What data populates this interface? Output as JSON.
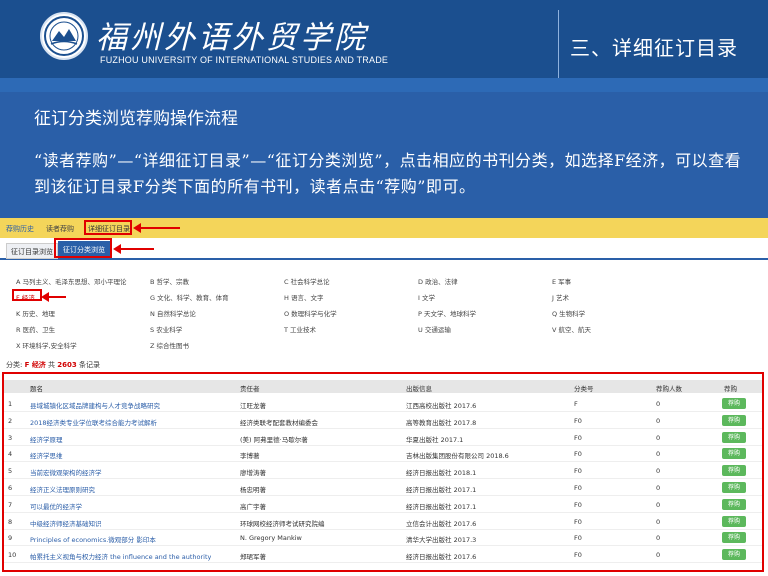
{
  "header": {
    "school_name_cn": "福州外语外贸学院",
    "school_name_en": "FUZHOU UNIVERSITY OF INTERNATIONAL STUDIES AND TRADE",
    "section_title": "三、详细征订目录"
  },
  "intro": {
    "title": "征订分类浏览荐购操作流程",
    "description": "“读者荐购”—“详细征订目录”—“征订分类浏览”，点击相应的书刊分类，如选择F经济，可以查看到该征订目录F分类下面的所有书刊，读者点击“荐购”即可。"
  },
  "nav": {
    "items": [
      "荐购历史",
      "读者荐购",
      "详细征订目录"
    ]
  },
  "tabs": {
    "items": [
      "征订目录浏览",
      "征订分类浏览"
    ]
  },
  "categories": [
    "A 马列主义、毛泽东思想、邓小平理论",
    "B 哲学、宗教",
    "C 社会科学总论",
    "D 政治、法律",
    "E 军事",
    "F 经济",
    "G 文化、科学、教育、体育",
    "H 语言、文字",
    "I 文学",
    "J 艺术",
    "K 历史、地理",
    "N 自然科学总论",
    "O 数理科学与化学",
    "P 天文学、地球科学",
    "Q 生物科学",
    "R 医药、卫生",
    "S 农业科学",
    "T 工业技术",
    "U 交通运输",
    "V 航空、航天",
    "X 环境科学,安全科学",
    "Z 综合性图书"
  ],
  "summary": {
    "prefix": "分类: ",
    "category": "F 经济",
    "mid": " 共 ",
    "count": "2603",
    "suffix": " 条记录"
  },
  "table": {
    "headers": [
      "题名",
      "责任者",
      "出版信息",
      "分类号",
      "荐购人数",
      "荐购"
    ],
    "rows": [
      {
        "no": "1",
        "title": "县域城镇化区域品牌建构与人才竞争战略研究",
        "author": "江旺龙著",
        "pub": "江西高校出版社 2017.6",
        "class": "F",
        "count": "0",
        "buy": "荐购"
      },
      {
        "no": "2",
        "title": "2018经济类专业学位联考综合能力考试解析",
        "author": "经济类联考配套教材编委会",
        "pub": "高等教育出版社 2017.8",
        "class": "F0",
        "count": "0",
        "buy": "荐购"
      },
      {
        "no": "3",
        "title": "经济学原理",
        "author": "(美) 阿弗里德·马歇尔著",
        "pub": "华夏出版社 2017.1",
        "class": "F0",
        "count": "0",
        "buy": "荐购"
      },
      {
        "no": "4",
        "title": "经济学思维",
        "author": "李博著",
        "pub": "吉林出版集团股份有限公司 2018.6",
        "class": "F0",
        "count": "0",
        "buy": "荐购"
      },
      {
        "no": "5",
        "title": "当前宏微观架构的经济学",
        "author": "廖增涛著",
        "pub": "经济日报出版社 2018.1",
        "class": "F0",
        "count": "0",
        "buy": "荐购"
      },
      {
        "no": "6",
        "title": "经济正义法理原则研究",
        "author": "杨忠明著",
        "pub": "经济日报出版社 2017.1",
        "class": "F0",
        "count": "0",
        "buy": "荐购"
      },
      {
        "no": "7",
        "title": "可以最优的经济学",
        "author": "高广宇著",
        "pub": "经济日报出版社 2017.1",
        "class": "F0",
        "count": "0",
        "buy": "荐购"
      },
      {
        "no": "8",
        "title": "中级经济师经济基础知识",
        "author": "环球网校经济师考试研究院编",
        "pub": "立信会计出版社 2017.6",
        "class": "F0",
        "count": "0",
        "buy": "荐购"
      },
      {
        "no": "9",
        "title": "Principles of economics.微观部分 影印本",
        "author": "N. Gregory Mankiw",
        "pub": "清华大学出版社 2017.3",
        "class": "F0",
        "count": "0",
        "buy": "荐购"
      },
      {
        "no": "10",
        "title": "帕累托主义视角与权力经济 the influence and the authority",
        "author": "郑珺军著",
        "pub": "经济日报出版社 2017.6",
        "class": "F0",
        "count": "0",
        "buy": "荐购"
      }
    ]
  }
}
